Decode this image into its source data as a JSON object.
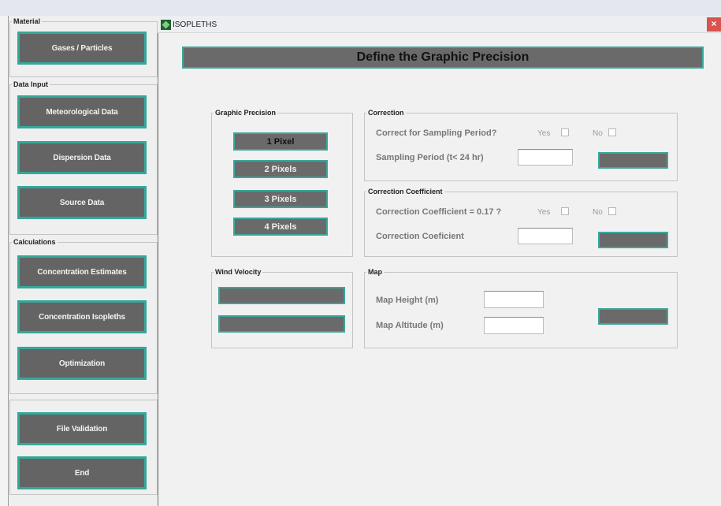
{
  "sidebar": {
    "material": {
      "legend": "Material",
      "gases_particles": "Gases / Particles"
    },
    "data_input": {
      "legend": "Data Input",
      "meteorological": "Meteorological Data",
      "dispersion": "Dispersion Data",
      "source": "Source Data"
    },
    "calculations": {
      "legend": "Calculations",
      "concentration_estimates": "Concentration Estimates",
      "concentration_isopleths": "Concentration Isopleths",
      "optimization": "Optimization"
    },
    "misc": {
      "file_validation": "File Validation",
      "end": "End"
    }
  },
  "window": {
    "title": "ISOPLETHS",
    "close_glyph": "×"
  },
  "main": {
    "header": "Define the Graphic Precision",
    "graphic_precision": {
      "legend": "Graphic Precision",
      "options": [
        "1 Pixel",
        "2 Pixels",
        "3 Pixels",
        "4 Pixels"
      ],
      "selected_index": 0
    },
    "correction": {
      "legend": "Correction",
      "question": "Correct for Sampling Period?",
      "yes": "Yes",
      "no": "No",
      "sampling_label": "Sampling Period  (t< 24 hr)",
      "sampling_value": ""
    },
    "correction_coefficient": {
      "legend": "Correction Coefficient",
      "question": "Correction Coefficient = 0.17 ?",
      "yes": "Yes",
      "no": "No",
      "coef_label": "Correction Coeficient",
      "coef_value": ""
    },
    "wind_velocity": {
      "legend": "Wind Velocity"
    },
    "map": {
      "legend": "Map",
      "height_label": "Map Height (m)",
      "altitude_label": "Map Altitude (m)",
      "height_value": "",
      "altitude_value": ""
    }
  },
  "colors": {
    "button_fill": "#646464",
    "button_border": "#34a89a",
    "header_fill": "#6a6a6a"
  }
}
